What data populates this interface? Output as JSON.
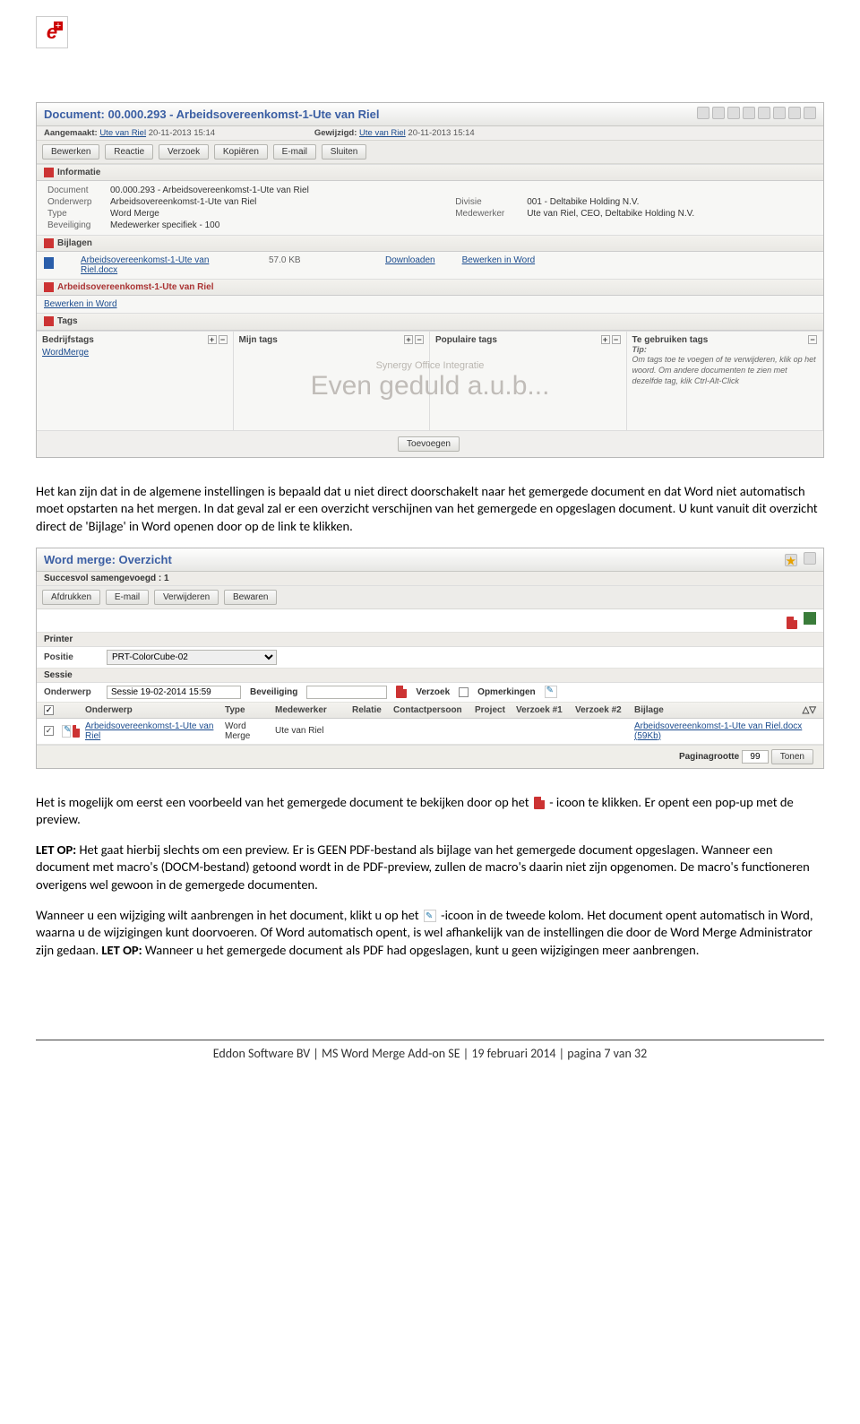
{
  "s1": {
    "title": "Document: 00.000.293 - Arbeidsovereenkomst-1-Ute van Riel",
    "aang_label": "Aangemaakt:",
    "aang_link": "Ute van Riel",
    "aang_date": "20-11-2013 15:14",
    "gew_label": "Gewijzigd:",
    "gew_link": "Ute van Riel",
    "gew_date": "20-11-2013 15:14",
    "btns": {
      "b1": "Bewerken",
      "b2": "Reactie",
      "b3": "Verzoek",
      "b4": "Kopiëren",
      "b5": "E-mail",
      "b6": "Sluiten"
    },
    "sect_info": "Informatie",
    "f_document_l": "Document",
    "f_document": "00.000.293 - Arbeidsovereenkomst-1-Ute van Riel",
    "f_onderwerp_l": "Onderwerp",
    "f_onderwerp": "Arbeidsovereenkomst-1-Ute van Riel",
    "f_type_l": "Type",
    "f_type": "Word Merge",
    "f_bev_l": "Beveiliging",
    "f_bev": "Medewerker specifiek - 100",
    "f_div_l": "Divisie",
    "f_div": "001 - Deltabike Holding N.V.",
    "f_med_l": "Medewerker",
    "f_med": "Ute van Riel, CEO, Deltabike Holding N.V.",
    "sect_bijlagen": "Bijlagen",
    "att_name": "Arbeidsovereenkomst-1-Ute van Riel.docx",
    "att_size": "57.0 KB",
    "att_dl": "Downloaden",
    "att_bw": "Bewerken in Word",
    "sect_doc": "Arbeidsovereenkomst-1-Ute van Riel",
    "bewerken_word": "Bewerken in Word",
    "sect_tags": "Tags",
    "tag_h1": "Bedrijfstags",
    "tag_h2": "Mijn tags",
    "tag_h3": "Populaire tags",
    "tag_h4": "Te gebruiken tags",
    "tag_link": "WordMerge",
    "tip_head": "Tip:",
    "tip_body": "Om tags toe te voegen of te verwijderen, klik op het woord. Om andere documenten te zien met dezelfde tag, klik Ctrl-Alt-Click",
    "wm_sub": "Synergy Office Integratie",
    "wm_main": "Even geduld a.u.b...",
    "toevoegen": "Toevoegen"
  },
  "p1": "Het kan zijn dat in de algemene instellingen is bepaald dat u niet direct doorschakelt naar het gemergede document en dat Word niet automatisch moet opstarten na het mergen. In dat geval zal er een overzicht verschijnen van het gemergede en opgeslagen document. U kunt vanuit dit overzicht direct de 'Bijlage' in Word openen door op de link te klikken.",
  "s2": {
    "title": "Word merge: Overzicht",
    "succ": "Succesvol samengevoegd : 1",
    "btns": {
      "b1": "Afdrukken",
      "b2": "E-mail",
      "b3": "Verwijderen",
      "b4": "Bewaren"
    },
    "printer": "Printer",
    "positie_l": "Positie",
    "positie": "PRT-ColorCube-02",
    "sessie": "Sessie",
    "onderwerp_l": "Onderwerp",
    "onderwerp": "Sessie 19-02-2014 15:59",
    "bev_l": "Beveiliging",
    "verzoek_l": "Verzoek",
    "opm_l": "Opmerkingen",
    "th_onderwerp": "Onderwerp",
    "th_type": "Type",
    "th_med": "Medewerker",
    "th_rel": "Relatie",
    "th_cp": "Contactpersoon",
    "th_proj": "Project",
    "th_v1": "Verzoek #1",
    "th_v2": "Verzoek #2",
    "th_bijlage": "Bijlage",
    "r_onderwerp": "Arbeidsovereenkomst-1-Ute van Riel",
    "r_type": "Word Merge",
    "r_med": "Ute van Riel",
    "r_bijlage": "Arbeidsovereenkomst-1-Ute van Riel.docx (59Kb)",
    "pager_l": "Paginagrootte",
    "pager_v": "99",
    "tonen": "Tonen"
  },
  "p2_a": "Het is mogelijk om eerst een voorbeeld van het gemergede document te bekijken door op het ",
  "p2_b": " - icoon te klikken. Er opent een pop-up met de preview.",
  "p3_a": "LET OP:",
  "p3_b": " Het gaat hierbij slechts om een preview. Er is GEEN PDF-bestand als bijlage van het gemergede document opgeslagen. Wanneer een document met macro's (DOCM-bestand) getoond wordt in de PDF-preview, zullen de macro's daarin niet zijn opgenomen. De macro's functioneren overigens wel gewoon in de gemergede documenten.",
  "p4_a": "Wanneer u een wijziging wilt aanbrengen in het document, klikt u op het ",
  "p4_b": " -icoon in de tweede kolom. Het document opent automatisch in Word, waarna u de wijzigingen kunt doorvoeren. Of Word automatisch opent, is wel afhankelijk van de instellingen die door de Word Merge Administrator zijn gedaan. ",
  "p4_c": "LET OP:",
  "p4_d": " Wanneer u het gemergede document als PDF had opgeslagen, kunt u geen wijzigingen meer aanbrengen.",
  "footer": "Eddon Software BV | MS Word Merge Add-on SE | 19 februari 2014 | pagina 7 van 32"
}
